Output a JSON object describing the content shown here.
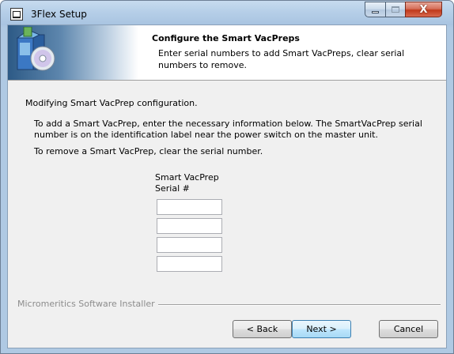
{
  "window": {
    "title": "3Flex Setup",
    "controls": {
      "minimize": "minimize",
      "maximize": "maximize",
      "close": "X"
    }
  },
  "header": {
    "title": "Configure the Smart VacPreps",
    "subtitle": "Enter serial numbers to add Smart VacPreps, clear serial numbers to remove."
  },
  "body": {
    "modifying_text": "Modifying Smart VacPrep configuration.",
    "add_instructions": "To add a Smart VacPrep, enter the necessary information below. The SmartVacPrep serial number is on the identification label near the power switch on the master unit.",
    "remove_instructions": "To remove a Smart VacPrep, clear the serial number.",
    "serial_header_line1": "Smart VacPrep",
    "serial_header_line2": "Serial #",
    "serial_fields": [
      "",
      "",
      "",
      ""
    ]
  },
  "footer": {
    "installer_label": "Micromeritics Software Installer",
    "back_label": "< Back",
    "next_label": "Next >",
    "cancel_label": "Cancel"
  },
  "colors": {
    "accent": "#3c7fb1",
    "close_button": "#c0391b",
    "dialog_background": "#f0f0f0"
  },
  "icons": [
    "application-icon",
    "setup-cd-icon",
    "minimize-icon",
    "maximize-icon",
    "close-icon"
  ]
}
